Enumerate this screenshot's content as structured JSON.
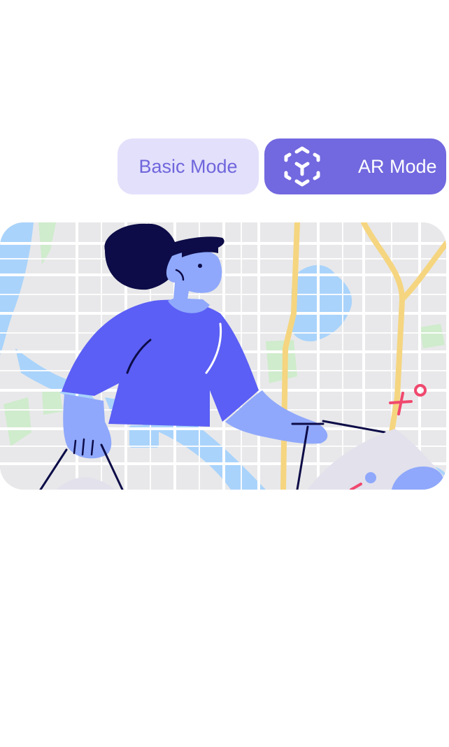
{
  "mode_switch": {
    "basic_label": "Basic Mode",
    "ar_label": "AR Mode",
    "active": "ar"
  },
  "icons": {
    "ar": "ar-cube-icon"
  },
  "illustration": {
    "subject": "woman-carrying-bags-over-map"
  },
  "colors": {
    "basic_bg": "#e3e0fb",
    "basic_text": "#6f66dc",
    "ar_bg": "#7268df",
    "ar_text": "#ffffff",
    "map_bg": "#e8e8ea",
    "water": "#a9d3fb",
    "park": "#cfeccc",
    "highway": "#f5d57f",
    "shirt": "#5b5ff5",
    "skin": "#8fa8fb",
    "hair": "#0d0c48",
    "pin": "#f0486e"
  }
}
